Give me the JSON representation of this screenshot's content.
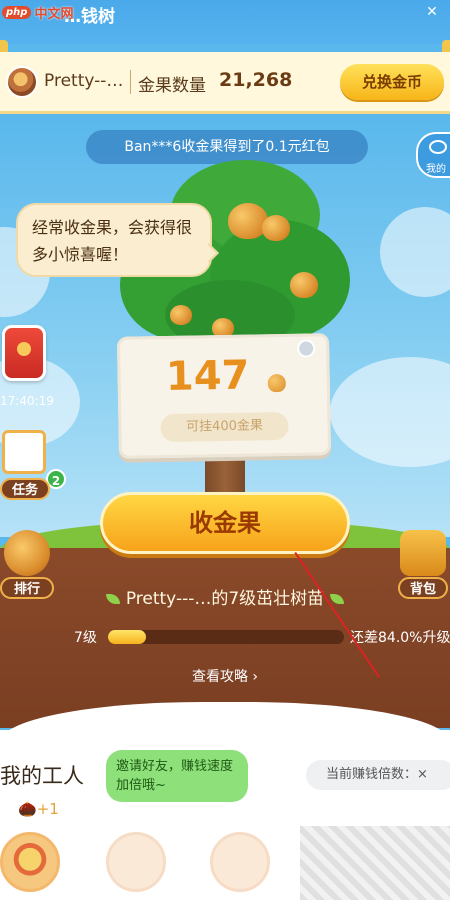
{
  "watermark": {
    "badge": "php",
    "text": "中文网"
  },
  "app": {
    "title": "…钱树"
  },
  "user": {
    "name": "Pretty--…",
    "count_label": "金果数量",
    "count_value": "21,268",
    "exchange_label": "兑换金币"
  },
  "ticker": "Ban***6收金果得到了0.1元红包",
  "mine_label": "我的",
  "bubble": "经常收金果，会获得很多小惊喜喔！",
  "board": {
    "value": "147",
    "capacity": "可挂400金果"
  },
  "timer": "17:40:19",
  "tasks": {
    "label": "任务",
    "badge": "2"
  },
  "rank_label": "排行",
  "bag_label": "背包",
  "collect_label": "收金果",
  "tree": {
    "owner_text": "Pretty---…的7级茁壮树苗",
    "level": "7级",
    "progress": 0.16,
    "remaining_text": "还差84.0%升级"
  },
  "guide_text": "查看攻略 ›",
  "workers": {
    "title": "我的工人",
    "invite": "邀请好友，赚钱速度加倍哦~",
    "multiplier": "当前赚钱倍数：×",
    "bonus": "+1"
  },
  "colors": {
    "sky": "#5ab8ec",
    "button": "#f7a31b",
    "soil": "#8a4a2a"
  }
}
